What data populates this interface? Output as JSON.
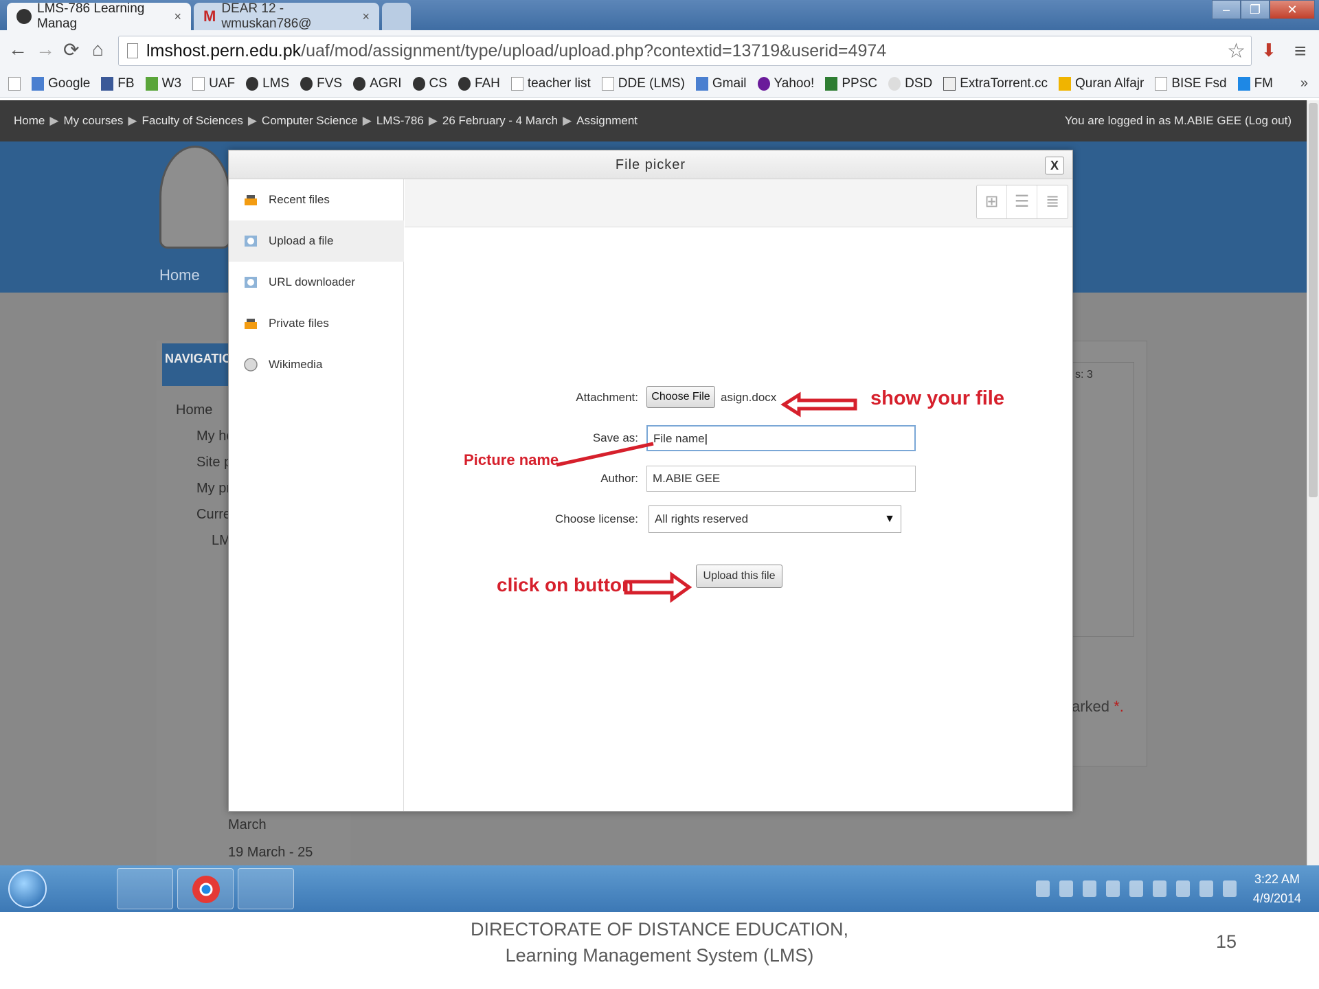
{
  "browser": {
    "tabs": [
      {
        "title": "LMS-786 Learning Manag",
        "close": "×"
      },
      {
        "title": "DEAR 12 - wmuskan786@",
        "close": "×"
      }
    ],
    "url_host": "lmshost.pern.edu.pk",
    "url_path": "/uaf/mod/assignment/type/upload/upload.php?contextid=13719&userid=4974",
    "bookmarks": [
      "Google",
      "FB",
      "W3",
      "UAF",
      "LMS",
      "FVS",
      "AGRI",
      "CS",
      "FAH",
      "teacher list",
      "DDE (LMS)",
      "Gmail",
      "Yahoo!",
      "PPSC",
      "DSD",
      "ExtraTorrent.cc",
      "Quran Alfajr",
      "BISE Fsd",
      "FM"
    ],
    "bookmarks_more": "»"
  },
  "moodle": {
    "breadcrumb": [
      "Home",
      "My courses",
      "Faculty of Sciences",
      "Computer Science",
      "LMS-786",
      "26 February - 4 March",
      "Assignment"
    ],
    "breadcrumb_sep": "▶",
    "login_text": "You are logged in as M.ABIE GEE (Log out)",
    "home_tab": "Home",
    "nav_heading": "NAVIGATION",
    "nav_items": [
      "Home",
      "My ho",
      "Site p",
      "My pr",
      "Curre",
      "LM",
      "March",
      "19 March - 25"
    ],
    "right_fragment": "s: 3",
    "marked_text": "arked",
    "marked_req": "*."
  },
  "picker": {
    "title": "File picker",
    "close": "X",
    "repositories": [
      "Recent files",
      "Upload a file",
      "URL downloader",
      "Private files",
      "Wikimedia"
    ],
    "labels": {
      "attachment": "Attachment:",
      "save_as": "Save as:",
      "author": "Author:",
      "license": "Choose license:"
    },
    "choose_file_button": "Choose File",
    "selected_file": "asign.docx",
    "save_as_value": "File name",
    "author_value": "M.ABIE GEE",
    "license_value": "All rights reserved",
    "upload_button": "Upload this file"
  },
  "annotations": {
    "show_file": "show your file",
    "picture_name": "Picture name",
    "click_button": "click on button"
  },
  "taskbar": {
    "time": "3:22 AM",
    "date": "4/9/2014"
  },
  "slide": {
    "footer_line1": "DIRECTORATE OF DISTANCE EDUCATION,",
    "footer_line2": "Learning Management System (LMS)",
    "page_number": "15"
  },
  "colors": {
    "annotation_red": "#d6202c",
    "moodle_blue": "#2f5f8f",
    "overlay_gray": "#888888"
  }
}
